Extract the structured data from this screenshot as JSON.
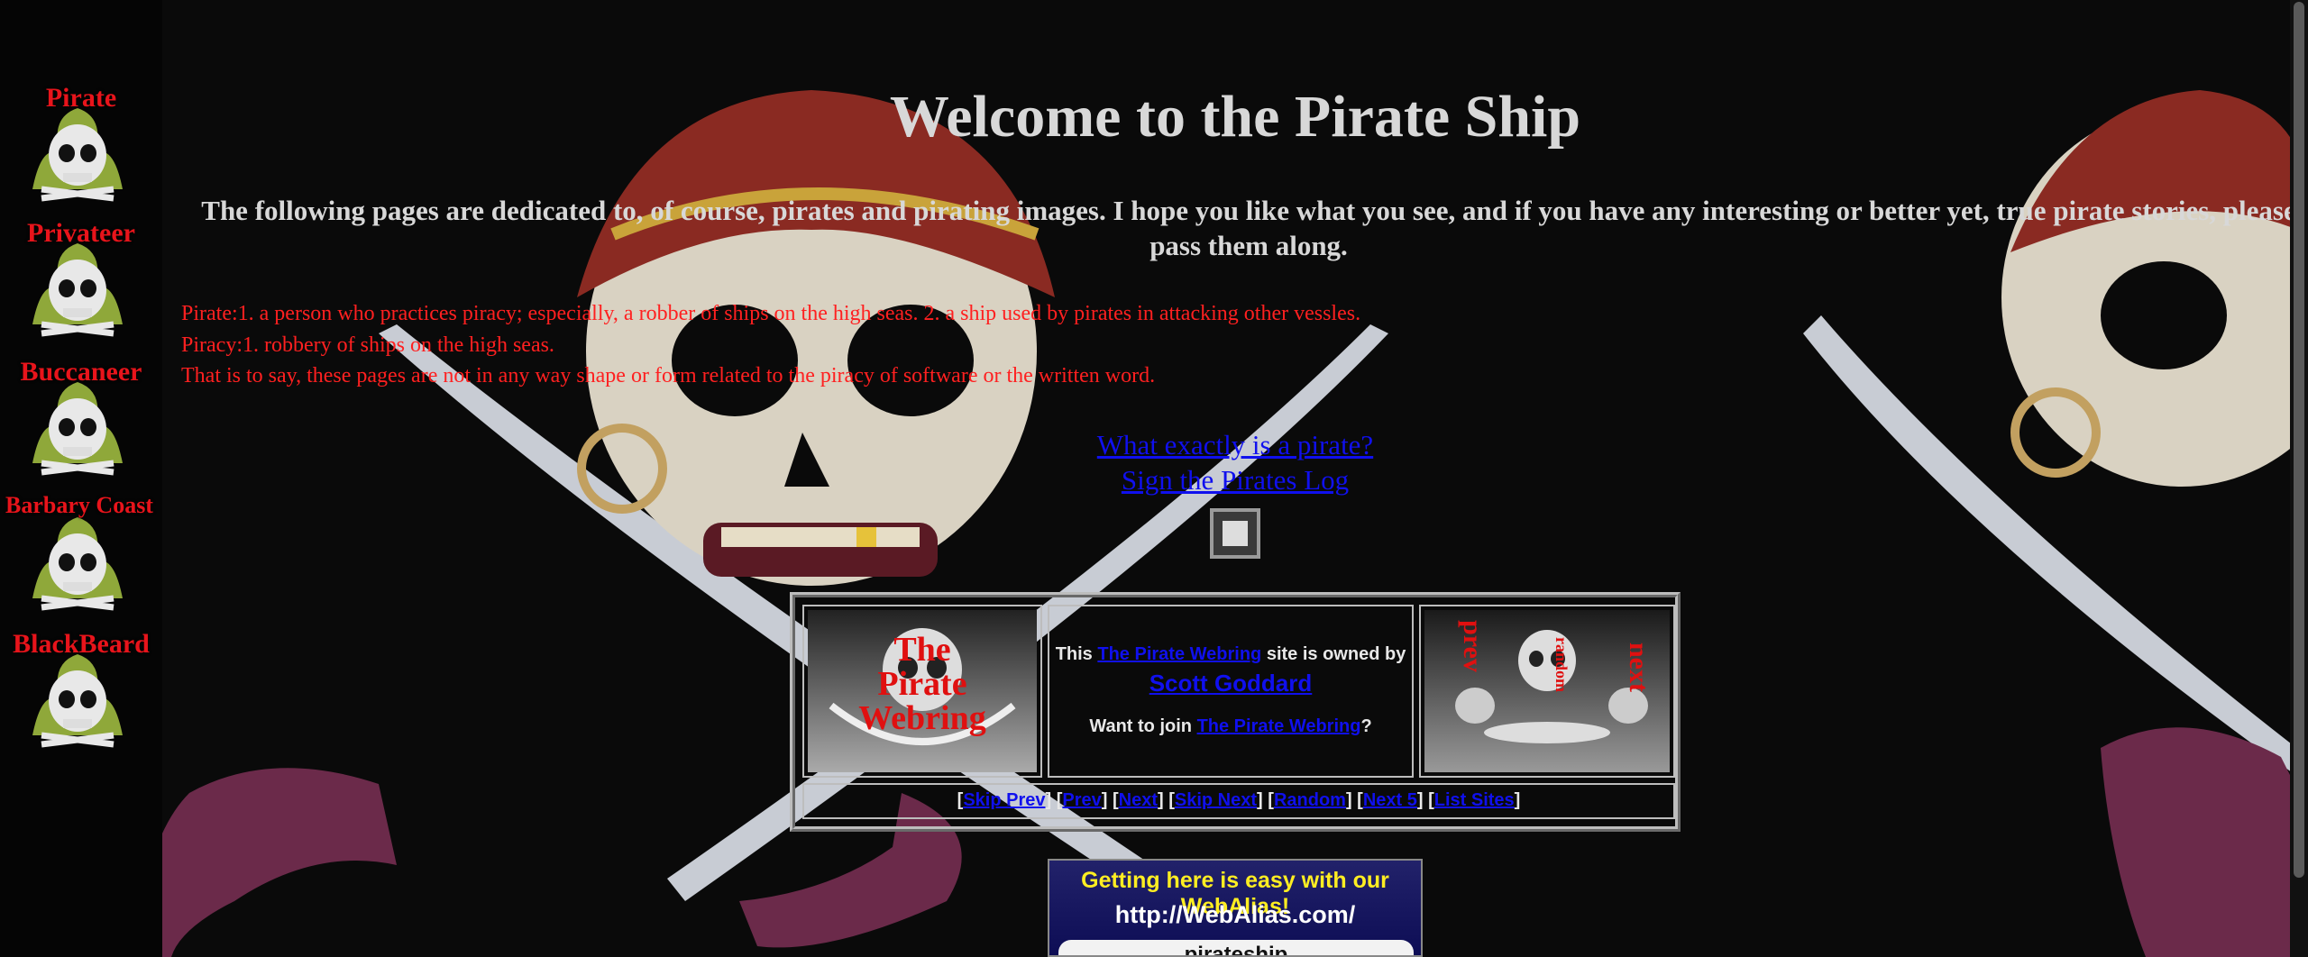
{
  "sidebar": {
    "items": [
      {
        "label": "Pirate"
      },
      {
        "label": "Privateer"
      },
      {
        "label": "Buccaneer"
      },
      {
        "label": "Barbary Coast"
      },
      {
        "label": "BlackBeard"
      }
    ]
  },
  "main": {
    "title": "Welcome to the Pirate Ship",
    "intro": "The following pages are dedicated to, of course, pirates and pirating images. I hope you like what you see, and if you have any interesting or better yet, true pirate stories, please pass them along.",
    "definitions": [
      "Pirate:1. a person who practices piracy; especially, a robber of ships on the high seas. 2. a ship used by pirates in attacking other vessles.",
      "Piracy:1. robbery of ships on the high seas.",
      "That is to say, these pages are not in any way shape or form related to the piracy of software or the written word."
    ],
    "links": {
      "what_is_pirate": "What exactly is a pirate?",
      "sign_log": "Sign the Pirates Log"
    }
  },
  "webring": {
    "logo_text": [
      "The",
      "Pirate",
      "Webring"
    ],
    "owner_prefix": "This",
    "ring_name": "The Pirate Webring",
    "owner_suffix": "site is owned by",
    "owner_name": "Scott Goddard",
    "join_prefix": "Want to join",
    "join_link": "The Pirate Webring",
    "join_suffix": "?",
    "nav_prev": "prev",
    "nav_random": "random",
    "nav_next": "next",
    "bottom_links": [
      "Skip Prev",
      "Prev",
      "Next",
      "Skip Next",
      "Random",
      "Next 5",
      "List Sites"
    ]
  },
  "banner": {
    "line1": "Getting here is easy with our WebAlias!",
    "line2": "http://WebAlias.com/",
    "line3": "pirateship"
  },
  "colors": {
    "title": "#d8d8d8",
    "definition": "#ff2020",
    "link": "#1010ee",
    "sidebar_label": "#e8141b"
  }
}
